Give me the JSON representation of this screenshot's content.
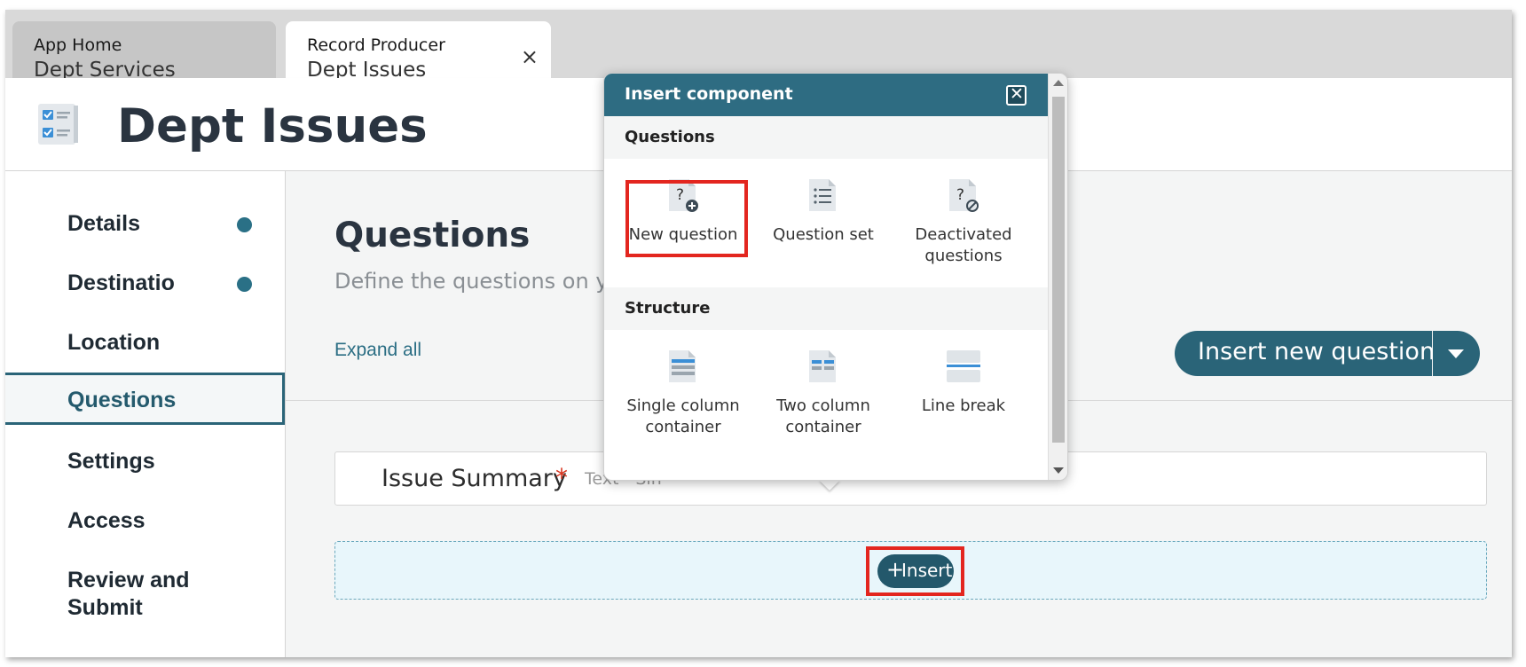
{
  "tabs": [
    {
      "line1": "App Home",
      "line2": "Dept Services"
    },
    {
      "line1": "Record Producer",
      "line2": "Dept Issues",
      "close": "×"
    }
  ],
  "header": {
    "title": "Dept Issues"
  },
  "sidebar": {
    "items": [
      {
        "label": "Details",
        "status": "dot"
      },
      {
        "label": "Destinatio",
        "status": "dot"
      },
      {
        "label": "Location"
      },
      {
        "label": "Questions",
        "active": true
      },
      {
        "label": "Settings"
      },
      {
        "label": "Access"
      },
      {
        "label": "Review and Submit"
      }
    ]
  },
  "main": {
    "heading": "Questions",
    "subheading": "Define the questions on your it",
    "expand_all": "Expand all",
    "insert_new_question": "Insert new question",
    "question_row": {
      "label": "Issue Summary",
      "required_marker": "*",
      "type": "Text - Sin"
    },
    "insert_button": {
      "plus": "+",
      "label": "Insert"
    }
  },
  "popover": {
    "title": "Insert component",
    "close": "✕",
    "sections": [
      {
        "label": "Questions",
        "items": [
          {
            "label": "New question",
            "icon": "new-question-icon"
          },
          {
            "label": "Question set",
            "icon": "question-set-icon"
          },
          {
            "label": "Deactivated questions",
            "icon": "deactivated-questions-icon"
          }
        ]
      },
      {
        "label": "Structure",
        "items": [
          {
            "label": "Single column container",
            "icon": "single-column-icon"
          },
          {
            "label": "Two column container",
            "icon": "two-column-icon"
          },
          {
            "label": "Line break",
            "icon": "line-break-icon"
          }
        ]
      }
    ]
  },
  "colors": {
    "accent": "#2a6478",
    "popover_header": "#2e6c82",
    "highlight": "#e3261f",
    "required": "#d8341e"
  }
}
